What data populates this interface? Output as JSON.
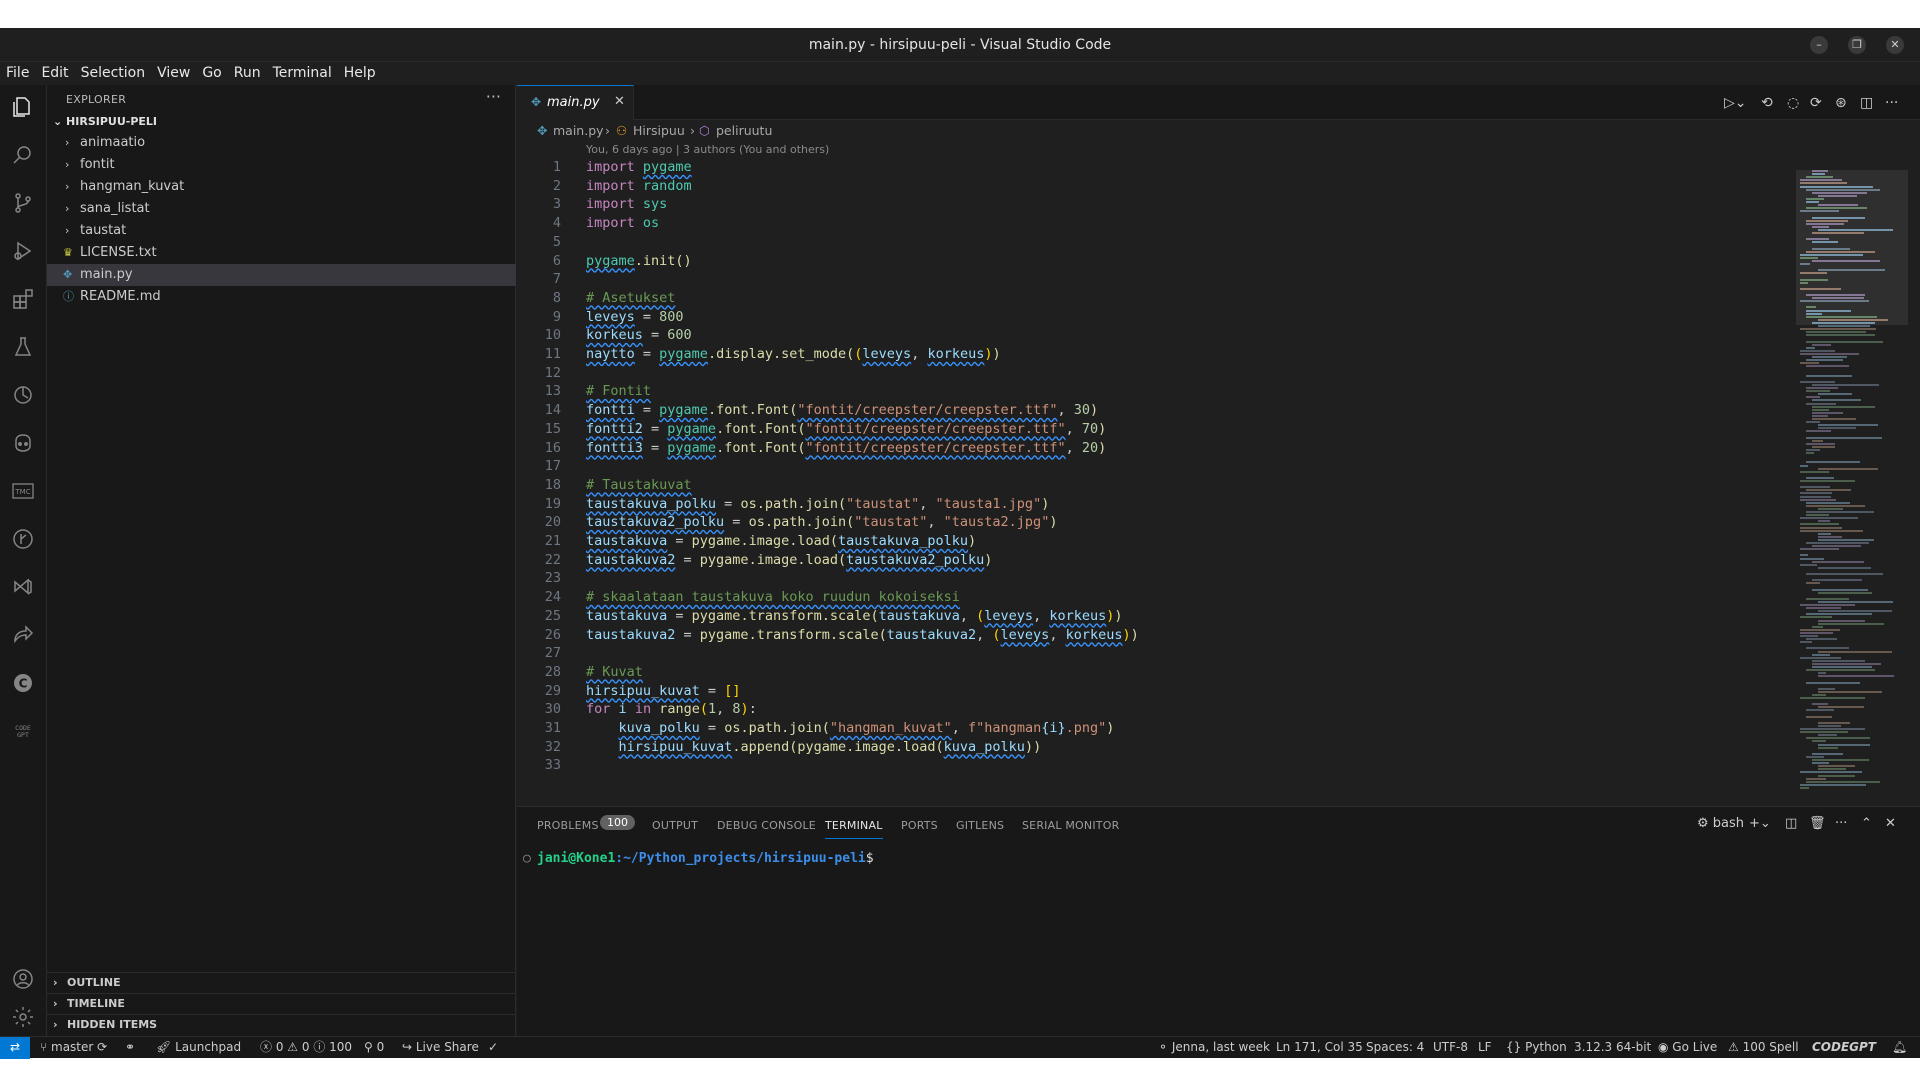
{
  "window": {
    "title": "main.py - hirsipuu-peli - Visual Studio Code",
    "minimize": "–",
    "restore": "❐",
    "close": "✕"
  },
  "menu": [
    "File",
    "Edit",
    "Selection",
    "View",
    "Go",
    "Run",
    "Terminal",
    "Help"
  ],
  "explorer": {
    "header": "EXPLORER",
    "more": "···",
    "root": "HIRSIPUU-PELI",
    "folders": [
      "animaatio",
      "fontit",
      "hangman_kuvat",
      "sana_listat",
      "taustat"
    ],
    "files": [
      "LICENSE.txt",
      "main.py",
      "README.md"
    ],
    "sections": [
      "OUTLINE",
      "TIMELINE",
      "HIDDEN ITEMS"
    ]
  },
  "tab": {
    "label": "main.py",
    "close": "✕"
  },
  "breadcrumb": {
    "file": "main.py",
    "class": "Hirsipuu",
    "method": "peliruutu"
  },
  "blame": "You, 6 days ago | 3 authors (You and others)",
  "code": {
    "l1": "1",
    "l2": "2",
    "l3": "3",
    "l4": "4",
    "l5": "5",
    "l6": "6",
    "l7": "7",
    "l8": "8",
    "l9": "9",
    "l10": "10",
    "l11": "11",
    "l12": "12",
    "l13": "13",
    "l14": "14",
    "l15": "15",
    "l16": "16",
    "l17": "17",
    "l18": "18",
    "l19": "19",
    "l20": "20",
    "l21": "21",
    "l22": "22",
    "l23": "23",
    "l24": "24",
    "l25": "25",
    "l26": "26",
    "l27": "27",
    "l28": "28",
    "l29": "29",
    "l30": "30",
    "l31": "31",
    "l32": "32",
    "l33": "33",
    "kw_import": "import",
    "kw_for": "for",
    "kw_in": "in",
    "mod_pygame": "pygame",
    "mod_random": "random",
    "mod_sys": "sys",
    "mod_os": "os",
    "init_call": ".init()",
    "c_asetukset": "# Asetukset",
    "v_leveys": "leveys",
    "v_korkeus": "korkeus",
    "n_800": "800",
    "n_600": "600",
    "v_naytto": "naytto",
    "display_call": ".display.set_mode(",
    "c_fontit": "# Fontit",
    "v_fontti": "fontti",
    "v_fontti2": "fontti2",
    "v_fontti3": "fontti3",
    "font_call": ".font.Font(",
    "s_font_a": "\"fontit/creepster/creepster.ttf\"",
    "n_30": "30",
    "n_70": "70",
    "n_20": "20",
    "c_taustakuvat": "# Taustakuvat",
    "v_tk_polku": "taustakuva_polku",
    "v_tk2_polku": "taustakuva2_polku",
    "os_join": "os.path.join(",
    "s_taustat": "\"taustat\"",
    "s_tausta1": "\"tausta1.jpg\"",
    "s_tausta2": "\"tausta2.jpg\"",
    "v_tk": "taustakuva",
    "v_tk2": "taustakuva2",
    "img_load": "pygame.image.load(",
    "c_skaalataan": "# skaalataan taustakuva koko ruudun kokoiseksi",
    "scale_call": "pygame.transform.scale(",
    "c_kuvat": "# Kuvat",
    "v_hk": "hirsipuu_kuvat",
    "empty_list": "[]",
    "v_i": "i",
    "f_range": "range",
    "n_1": "1",
    "n_8": "8",
    "v_kuva_polku": "kuva_polku",
    "s_hangman_kuvat": "\"hangman_kuvat\"",
    "s_fstr_a": "f\"hangman",
    "s_fstr_i": "{i}",
    "s_fstr_b": ".png\"",
    "append_call": ".append(",
    "eq": " = ",
    "comma": ", "
  },
  "panel": {
    "tabs": [
      "PROBLEMS",
      "OUTPUT",
      "DEBUG CONSOLE",
      "TERMINAL",
      "PORTS",
      "GITLENS",
      "SERIAL MONITOR"
    ],
    "problems_count": "100",
    "shell": "bash",
    "prompt_user": "jani@Kone1",
    "prompt_path": ":~/Python_projects/hirsipuu-peli",
    "prompt_sign": "$"
  },
  "status": {
    "branch": "master",
    "launchpad": "Launchpad",
    "errors": "0",
    "warnings": "0",
    "infos": "100",
    "ports": "0",
    "live_share": "Live Share",
    "blame": "Jenna, last week",
    "position": "Ln 171, Col 35",
    "spaces": "Spaces: 4",
    "encoding": "UTF-8",
    "eol": "LF",
    "language": "Python",
    "interpreter": "3.12.3 64-bit",
    "go_live": "Go Live",
    "spell": "100 Spell",
    "codegpt": "CODEGPT"
  },
  "colors": {
    "accent": "#0078d4",
    "keyword": "#c586c0",
    "string": "#ce9178",
    "comment": "#6a9955",
    "number": "#b5cea8",
    "variable": "#9cdcfe",
    "module": "#4ec9b0",
    "function": "#dcdcaa"
  }
}
